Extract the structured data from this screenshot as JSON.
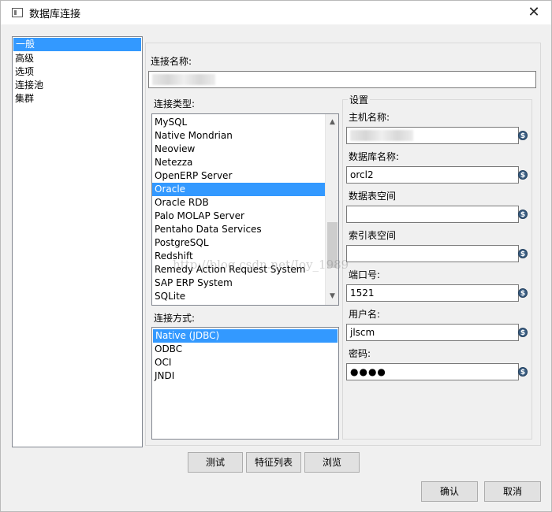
{
  "window": {
    "title": "数据库连接",
    "close_glyph": "✕"
  },
  "nav": {
    "items": [
      "一般",
      "高级",
      "选项",
      "连接池",
      "集群"
    ],
    "selected_index": 0
  },
  "connection_name": {
    "label": "连接名称:",
    "value": ""
  },
  "connection_type": {
    "label": "连接类型:",
    "items": [
      "MySQL",
      "Native Mondrian",
      "Neoview",
      "Netezza",
      "OpenERP Server",
      "Oracle",
      "Oracle RDB",
      "Palo MOLAP Server",
      "Pentaho Data Services",
      "PostgreSQL",
      "Redshift",
      "Remedy Action Request System",
      "SAP ERP System",
      "SQLite"
    ],
    "selected_index": 5
  },
  "access": {
    "label": "连接方式:",
    "items": [
      "Native (JDBC)",
      "ODBC",
      "OCI",
      "JNDI"
    ],
    "selected_index": 0
  },
  "settings": {
    "title": "设置",
    "host_label": "主机名称:",
    "host_value": "",
    "dbname_label": "数据库名称:",
    "dbname_value": "orcl2",
    "tablespace_label": "数据表空间",
    "tablespace_value": "",
    "index_tablespace_label": "索引表空间",
    "index_tablespace_value": "",
    "port_label": "端口号:",
    "port_value": "1521",
    "user_label": "用户名:",
    "user_value": "jlscm",
    "password_label": "密码:",
    "password_value": "●●●●"
  },
  "variable_icon_glyph": "$",
  "watermark": "http://blog.csdn.net/Joy_1989",
  "buttons": {
    "test": "测试",
    "features": "特征列表",
    "explore": "浏览",
    "ok": "确认",
    "cancel": "取消"
  }
}
